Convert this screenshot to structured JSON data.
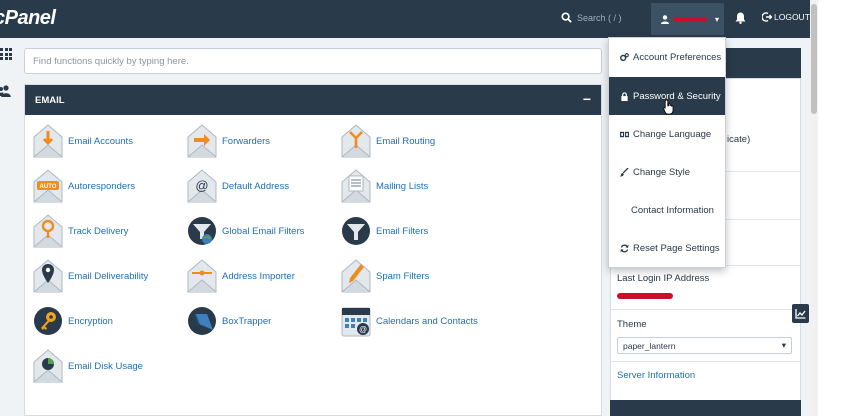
{
  "header": {
    "logo_text": "cPanel",
    "search_label": "Search ( / )",
    "logout_label": "LOGOUT"
  },
  "main": {
    "search_placeholder": "Find functions quickly by typing here.",
    "email_panel": {
      "title": "EMAIL",
      "toggle": "−",
      "items": [
        {
          "label": "Email Accounts",
          "icon": "email-accounts-icon"
        },
        {
          "label": "Forwarders",
          "icon": "forwarders-icon"
        },
        {
          "label": "Email Routing",
          "icon": "email-routing-icon"
        },
        {
          "label": "Autoresponders",
          "icon": "autoresponders-icon"
        },
        {
          "label": "Default Address",
          "icon": "default-address-icon"
        },
        {
          "label": "Mailing Lists",
          "icon": "mailing-lists-icon"
        },
        {
          "label": "Track Delivery",
          "icon": "track-delivery-icon"
        },
        {
          "label": "Global Email Filters",
          "icon": "global-email-filters-icon"
        },
        {
          "label": "Email Filters",
          "icon": "email-filters-icon"
        },
        {
          "label": "Email Deliverability",
          "icon": "email-deliverability-icon"
        },
        {
          "label": "Address Importer",
          "icon": "address-importer-icon"
        },
        {
          "label": "Spam Filters",
          "icon": "spam-filters-icon"
        },
        {
          "label": "Encryption",
          "icon": "encryption-icon"
        },
        {
          "label": "BoxTrapper",
          "icon": "boxtrapper-icon"
        },
        {
          "label": "Calendars and Contacts",
          "icon": "calendars-contacts-icon"
        },
        {
          "label": "Email Disk Usage",
          "icon": "email-disk-usage-icon"
        }
      ]
    }
  },
  "user_menu": {
    "items": [
      {
        "label": "Account Preferences",
        "icon": "gears-icon"
      },
      {
        "label": "Password & Security",
        "icon": "lock-icon",
        "active": true
      },
      {
        "label": "Change Language",
        "icon": "language-icon"
      },
      {
        "label": "Change Style",
        "icon": "brush-icon"
      },
      {
        "label": "Contact Information",
        "icon": ""
      },
      {
        "label": "Reset Page Settings",
        "icon": "refresh-icon"
      }
    ]
  },
  "sidebar_info": {
    "partial_text": "icate)",
    "last_login_label": "Last Login IP Address",
    "theme_label": "Theme",
    "theme_value": "paper_lantern",
    "server_info_link": "Server Information"
  },
  "colors": {
    "navy": "#293a4a",
    "link": "#1f6fb2",
    "redaction": "#c8102e"
  }
}
